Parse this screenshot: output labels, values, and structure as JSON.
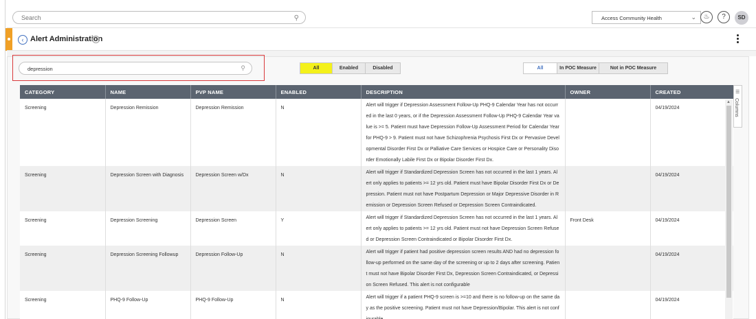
{
  "header": {
    "search_placeholder": "Search",
    "organization": "Access Community Health",
    "user_initials": "SD",
    "help_symbol": "?",
    "icons": [
      "search-icon",
      "chevron-down-icon",
      "bell-icon",
      "help-icon"
    ]
  },
  "page": {
    "title": "Alert Administration",
    "info_symbol": "i"
  },
  "filters": {
    "search_value": "depression",
    "status_options": [
      "All",
      "Enabled",
      "Disabled"
    ],
    "status_selected": "All",
    "poc_options": [
      "All",
      "In POC Measure",
      "Not in POC Measure"
    ],
    "poc_selected": "All"
  },
  "table": {
    "columns": [
      "CATEGORY",
      "NAME",
      "PVP NAME",
      "ENABLED",
      "DESCRIPTION",
      "OWNER",
      "CREATED"
    ],
    "rows": [
      {
        "category": "Screening",
        "name": "Depression Remission",
        "pvp_name": "Depression Remission",
        "enabled": "N",
        "description": "Alert will trigger if Depression Assessment Follow-Up PHQ-9 Calendar Year has not occurred in the last 0 years, or if the Depression Assessment Follow-Up PHQ-9 Calendar Year value is >= 5. Patient must have Depression Follow-Up Assessment Period for Calendar Year for PHQ-9 > 9. Patient must not have Schizophrenia Psychosis First Dx or Pervasive Developmental Disorder First Dx or Palliative Care Services or Hospice Care or Personality Disorder Emotionally Labile First Dx or Bipolar Disorder First Dx.",
        "owner": "",
        "created": "04/19/2024"
      },
      {
        "category": "Screening",
        "name": "Depression Screen with Diagnosis",
        "pvp_name": "Depression Screen w/Dx",
        "enabled": "N",
        "description": "Alert will trigger if Standardized Depression Screen has not occurred in the last 1 years. Alert only applies to patients >= 12 yrs old. Patient must have Bipolar Disorder First Dx or Depression. Patient must not have Postpartum Depression or Major Depressive Disorder in Remission or Depression Screen Refused or Depression Screen Contraindicated.",
        "owner": "",
        "created": "04/19/2024"
      },
      {
        "category": "Screening",
        "name": "Depression Screening",
        "pvp_name": "Depression Screen",
        "enabled": "Y",
        "description": "Alert will trigger if Standardized Depression Screen has not occurred in the last 1 years. Alert only applies to patients >= 12 yrs old. Patient must not have Depression Screen Refused or Depression Screen Contraindicated or Bipolar Disorder First Dx.",
        "owner": "Front Desk",
        "created": "04/19/2024"
      },
      {
        "category": "Screening",
        "name": "Depression Screening Followup",
        "pvp_name": "Depression Follow-Up",
        "enabled": "N",
        "description": "Alert will trigger if patient had positive depression screen results AND had no depression follow-up performed on the same day of the screening or up to 2 days after screening. Patient must not have Bipolar Disorder First Dx, Depression Screen Contraindicated, or Depression Screen Refused. This alert is not configurable",
        "owner": "",
        "created": "04/19/2024"
      },
      {
        "category": "Screening",
        "name": "PHQ-9 Follow-Up",
        "pvp_name": "PHQ-9 Follow-Up",
        "enabled": "N",
        "description": "Alert will trigger if a patient PHQ-9 screen is >=10 and there is no follow-up on the same day as the positive screening. Patient must not have Depression/Bipolar. This alert is not configurable",
        "owner": "",
        "created": "04/19/2024"
      }
    ]
  },
  "columns_panel": {
    "label": "Columns"
  },
  "colors": {
    "header_bg": "#5b6470",
    "accent_orange": "#f0a026",
    "highlight_yellow": "#f4f11b",
    "link_blue": "#3f6fbf",
    "annotation_red": "#d9383a"
  }
}
